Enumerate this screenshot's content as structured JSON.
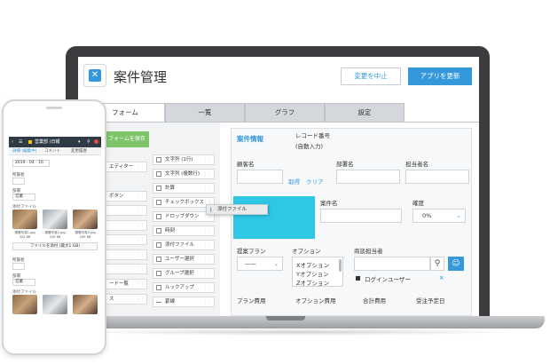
{
  "app": {
    "title": "案件管理",
    "cancel_label": "変更を中止",
    "update_label": "アプリを更新"
  },
  "tabs": [
    "フォーム",
    "一覧",
    "グラフ",
    "設定"
  ],
  "palette": {
    "save_label": "フォームを保存",
    "left_items": [
      "エディター",
      "ボタン",
      "",
      "",
      "",
      "",
      "",
      "",
      "ス"
    ],
    "right_items": [
      "文字列 (1行)",
      "文字列 (複数行)",
      "計算",
      "チェックボックス",
      "ドロップダウン",
      "時刻",
      "添付ファイル",
      "ユーザー選択",
      "グループ選択",
      "ルックアップ",
      "罫線"
    ],
    "left_extra": "ード一覧"
  },
  "dragging": "添付ファイル",
  "form": {
    "section_title": "案件情報",
    "record_no_label": "レコード番号",
    "record_no_value": "(自動入力)",
    "customer_label": "顧客名",
    "get_link": "取得",
    "clear_link": "クリア",
    "dept_label": "部署名",
    "contact_label": "担当者名",
    "deal_label": "案件名",
    "certainty_label": "確度",
    "certainty_value": "0%",
    "plan_label": "提案プラン",
    "plan_value": "——",
    "option_label": "オプション",
    "options": [
      "Xオプション",
      "Yオプション",
      "Zオプション"
    ],
    "owner_label": "商談担当者",
    "login_user": "ログインユーザー",
    "plan_fee_label": "プラン費用",
    "option_fee_label": "オプション費用",
    "total_label": "合計費用",
    "order_date_label": "受注予定日"
  },
  "phone": {
    "header": "営業部 (日報",
    "tabs": [
      "詳細 (編集中)",
      "コメント",
      "変更履歴"
    ],
    "date": "2019 - 04 - 16",
    "label1": "所属者",
    "label2": "部署",
    "select_value": "営業",
    "attach_label": "添付ファイル",
    "thumbs": [
      {
        "name": "現場写真1.jpg",
        "size": "322 KB"
      },
      {
        "name": "現場写真2.jpg",
        "size": "249 KB"
      },
      {
        "name": "現場写真3.jpg",
        "size": "290 KB"
      }
    ],
    "attach_button": "ファイルを添付 (最大1 GB)",
    "label3": "所属者",
    "label4": "部署",
    "select_value2": "営業",
    "attach_label2": "添付ファイル"
  },
  "colors": {
    "accent": "#3498db",
    "highlight": "#2ec7e6",
    "save": "#7dc46a"
  }
}
